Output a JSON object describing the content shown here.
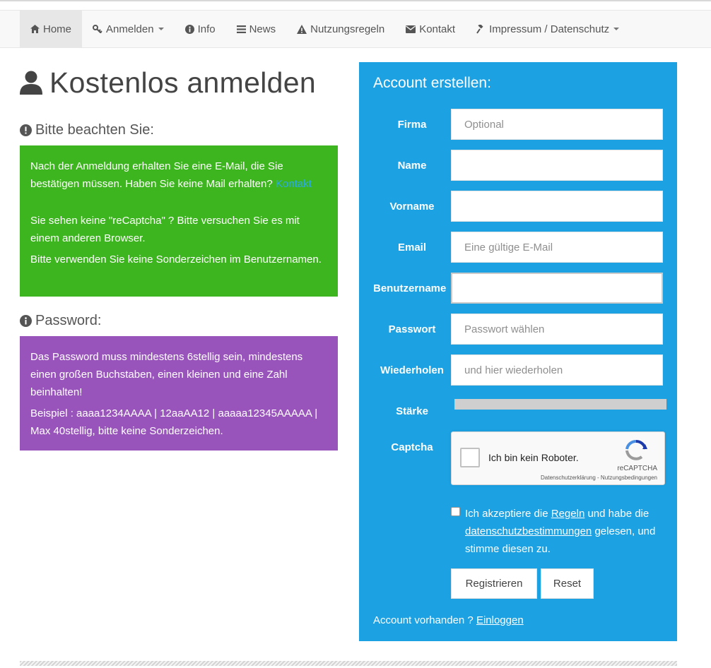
{
  "nav": {
    "items": [
      {
        "label": "Home",
        "icon": "home-icon",
        "active": true,
        "dropdown": false
      },
      {
        "label": "Anmelden",
        "icon": "key-icon",
        "active": false,
        "dropdown": true
      },
      {
        "label": "Info",
        "icon": "info-circle-icon",
        "active": false,
        "dropdown": false
      },
      {
        "label": "News",
        "icon": "list-icon",
        "active": false,
        "dropdown": false
      },
      {
        "label": "Nutzungsregeln",
        "icon": "warning-icon",
        "active": false,
        "dropdown": false
      },
      {
        "label": "Kontakt",
        "icon": "envelope-icon",
        "active": false,
        "dropdown": false
      },
      {
        "label": "Impressum / Datenschutz",
        "icon": "gavel-icon",
        "active": false,
        "dropdown": true
      }
    ]
  },
  "page": {
    "title": "Kostenlos anmelden",
    "notice_title": "Bitte beachten Sie:",
    "notice": {
      "text1": "Nach der Anmeldung erhalten Sie eine E-Mail, die Sie bestätigen müssen. Haben Sie keine Mail erhalten?",
      "link": "Kontakt",
      "text2": "Sie sehen keine \"reCaptcha\" ? Bitte versuchen Sie es mit einem anderen Browser.",
      "text3": "Bitte verwenden Sie keine Sonderzeichen im Benutzernamen."
    },
    "password_title": "Password:",
    "password_box": {
      "text1": "Das Password muss mindestens 6stellig sein, mindestens einen großen Buchstaben, einen kleinen und eine Zahl beinhalten!",
      "text2": "Beispiel : aaaa1234AAAA | 12aaAA12 | aaaaa12345AAAAA | Max 40stellig, bitte keine Sonderzeichen."
    }
  },
  "form": {
    "title": "Account erstellen:",
    "fields": {
      "firma": {
        "label": "Firma",
        "placeholder": "Optional",
        "value": ""
      },
      "name": {
        "label": "Name",
        "placeholder": "",
        "value": ""
      },
      "vorname": {
        "label": "Vorname",
        "placeholder": "",
        "value": ""
      },
      "email": {
        "label": "Email",
        "placeholder": "Eine gültige E-Mail",
        "value": ""
      },
      "benutzername": {
        "label": "Benutzername",
        "placeholder": "",
        "value": ""
      },
      "passwort": {
        "label": "Passwort",
        "placeholder": "Passwort wählen",
        "value": ""
      },
      "wiederholen": {
        "label": "Wiederholen",
        "placeholder": "und hier wiederholen",
        "value": ""
      }
    },
    "strength_label": "Stärke",
    "captcha_label": "Captcha",
    "captcha": {
      "text": "Ich bin kein Roboter.",
      "brand": "reCAPTCHA",
      "links": "Datenschutzerklärung - Nutzungsbedingungen"
    },
    "accept": {
      "pre": "Ich akzeptiere die",
      "rules_link": "Regeln",
      "mid": "und habe die",
      "privacy_link": "datenschutzbestimmungen",
      "post": "gelesen, und stimme diesen zu."
    },
    "register_button": "Registrieren",
    "reset_button": "Reset",
    "account_text": "Account vorhanden ?",
    "login_link": "Einloggen"
  },
  "colors": {
    "panel": "#1ca1e3",
    "notice_green": "#3db51e",
    "password_purple": "#9954bb",
    "navbar_bg": "#f8f8f8"
  }
}
